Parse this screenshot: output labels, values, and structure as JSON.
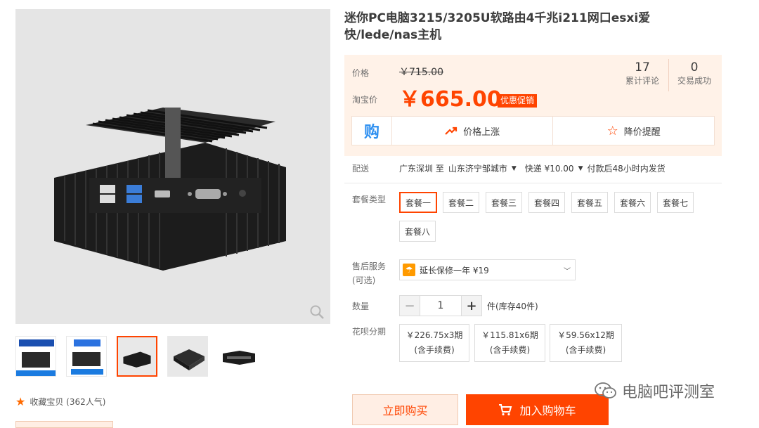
{
  "product": {
    "title": "迷你PC电脑3215/3205U软路由4千兆i211网口esxi爱快/lede/nas主机"
  },
  "gallery": {
    "thumb_count": 5,
    "active_index": 2
  },
  "favorite": {
    "label": "收藏宝贝 (362人气)"
  },
  "price": {
    "price_label": "价格",
    "original_price": "￥715.00",
    "taobao_label": "淘宝价",
    "taobao_price": "￥665.00",
    "promo_tag": "优惠促销",
    "reviews_count": "17",
    "reviews_label": "累计评论",
    "deals_count": "0",
    "deals_label": "交易成功"
  },
  "actions": {
    "gou_icon": "购",
    "price_up_label": "价格上涨",
    "price_drop_label": "降价提醒"
  },
  "shipping": {
    "label": "配送",
    "from": "广东深圳 至",
    "to": "山东济宁邹城市",
    "express": "快递 ¥10.00",
    "delivery": "付款后48小时内发货"
  },
  "package": {
    "label": "套餐类型",
    "options": [
      "套餐一",
      "套餐二",
      "套餐三",
      "套餐四",
      "套餐五",
      "套餐六",
      "套餐七",
      "套餐八"
    ],
    "selected": "套餐一"
  },
  "service": {
    "label": "售后服务",
    "optional": "(可选)",
    "value": "延长保修一年 ¥19"
  },
  "quantity": {
    "label": "数量",
    "value": "1",
    "minus": "−",
    "plus": "+",
    "stock": "件(库存40件)"
  },
  "installment": {
    "label": "花呗分期",
    "plans": [
      {
        "amount": "￥226.75x3期",
        "fee": "(含手续费)"
      },
      {
        "amount": "￥115.81x6期",
        "fee": "(含手续费)"
      },
      {
        "amount": "￥59.56x12期",
        "fee": "(含手续费)"
      }
    ]
  },
  "buttons": {
    "buy_now": "立即购买",
    "add_cart": "加入购物车"
  },
  "watermark": {
    "text": "电脑吧评测室"
  },
  "colors": {
    "accent": "#ff4400",
    "price_bg": "#fff2e8",
    "blue_icon": "#2d8ff0"
  }
}
